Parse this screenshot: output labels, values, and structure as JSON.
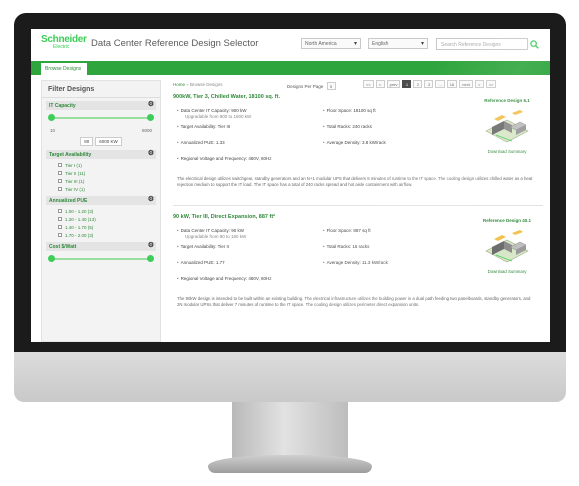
{
  "header": {
    "logo_top": "Schneider",
    "logo_bottom": "Electric",
    "app_title": "Data Center Reference Design Selector",
    "region_select": "North America",
    "language_select": "English",
    "search_placeholder": "Search Reference Designs"
  },
  "nav": {
    "tab_label": "Browse Designs"
  },
  "sidebar": {
    "title": "Filter Designs",
    "facets": [
      {
        "label": "IT Capacity",
        "min": "10",
        "max": "6000",
        "kw_low": "80",
        "kw_high": "6000 KW"
      },
      {
        "label": "Target Availability",
        "options": [
          "Tier I (1)",
          "Tier II (11)",
          "Tier III (1)",
          "Tier IV (1)"
        ]
      },
      {
        "label": "Annualized PUE",
        "options": [
          "1.00 - 1.20 (3)",
          "1.20 - 1.40 (13)",
          "1.40 - 1.70 (5)",
          "1.70 - 2.00 (3)"
        ]
      },
      {
        "label": "Cost $/Watt"
      }
    ]
  },
  "toolbar": {
    "crumb_home": "Home",
    "crumb_current": "Browse Designs",
    "per_page_label": "Designs Per Page",
    "per_page_value": "5",
    "pager": [
      "<<",
      "<",
      "prev",
      "1",
      "2",
      "3",
      "...",
      "16",
      "next",
      ">",
      ">>"
    ],
    "active_page": "1"
  },
  "results": [
    {
      "title": "900kW, Tier 3, Chilled Water, 18100 sq. ft.",
      "specs_left": [
        "Data Center IT Capacity: 900 kW",
        "Target Availability: Tier III",
        "Annualized PUE: 1.33",
        "Regional Voltage and Frequency: 480V, 60Hz"
      ],
      "spec_sub": "Upgradable from 900 to 1800 kW",
      "specs_right": [
        "Floor Space: 18100 sq ft",
        "Total Racks: 240 racks",
        "Average Density: 3.8 kW/rack"
      ],
      "description": "The electrical design utilizes switchgear, standby generators and an N+1 modular UPS that delivers 6 minutes of runtime to the IT space. The cooling design utilizes chilled water as a heat rejection medium to support the IT load. The IT space has a total of 240 racks spread and hot aisle containment with airflow.",
      "ref_label": "Reference Design 6.1",
      "download_label": "Download Summary"
    },
    {
      "title": "90 kW, Tier III, Direct Expansion, 887 ft²",
      "specs_left": [
        "Data Center IT Capacity: 90 kW",
        "Target Availability: Tier II",
        "Annualized PUE: 1.77",
        "Regional Voltage and Frequency: 480V, 60Hz"
      ],
      "spec_sub": "Upgradable from 90 to 180 kW",
      "specs_right": [
        "Floor Space: 887 sq ft",
        "Total Racks: 16 racks",
        "Average Density: 11.3 kW/rack"
      ],
      "description": "The 90kW design is intended to be built within an existing building. The electrical infrastructure utilizes the building power in a dual path feeding two panelboards, standby generators, and 2N modular UPSs that deliver 7 minutes of runtime to the IT space. The cooling design utilizes perimeter direct expansion units.",
      "ref_label": "Reference Design 40.1",
      "download_label": "Download Summary"
    }
  ]
}
